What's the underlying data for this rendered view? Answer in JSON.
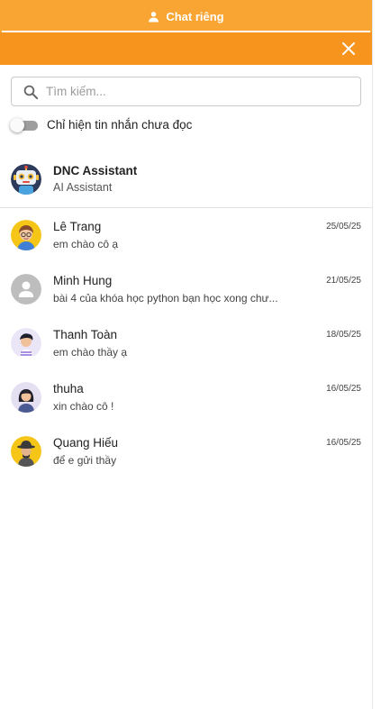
{
  "tab": {
    "label": "Chat riêng",
    "icon": "person-icon"
  },
  "header": {
    "close_icon": "close-icon"
  },
  "search": {
    "placeholder": "Tìm kiếm...",
    "value": ""
  },
  "unread_filter": {
    "label": "Chỉ hiện tin nhắn chưa đọc",
    "enabled": false
  },
  "assistant": {
    "name": "DNC Assistant",
    "subtitle": "AI Assistant"
  },
  "conversations": [
    {
      "name": "Lê Trang",
      "message": "em chào cô ạ",
      "date": "25/05/25"
    },
    {
      "name": "Minh Hung",
      "message": "bài 4 của khóa học python bạn học xong chư...",
      "date": "21/05/25"
    },
    {
      "name": "Thanh Toàn",
      "message": "em chào thầy ạ",
      "date": "18/05/25"
    },
    {
      "name": "thuha",
      "message": "xin chào cô !",
      "date": "16/05/25"
    },
    {
      "name": "Quang Hiếu",
      "message": "để e gửi thầy",
      "date": "16/05/25"
    }
  ],
  "colors": {
    "tab_bar": "#f9a533",
    "header": "#f7941d",
    "toggle_off": "#9e9e9e"
  }
}
